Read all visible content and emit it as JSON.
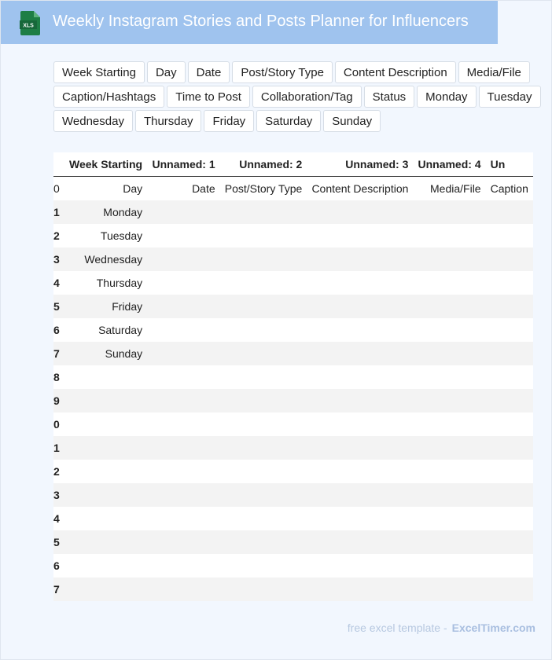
{
  "header": {
    "title": "Weekly Instagram Stories and Posts Planner for Influencers",
    "file_badge": "XLS",
    "accent_color": "#9fc3ee",
    "icon_color": "#1e7e45"
  },
  "chips": [
    "Week Starting",
    "Day",
    "Date",
    "Post/Story Type",
    "Content Description",
    "Media/File",
    "Caption/Hashtags",
    "Time to Post",
    "Collaboration/Tag",
    "Status",
    "Monday",
    "Tuesday",
    "Wednesday",
    "Thursday",
    "Friday",
    "Saturday",
    "Sunday"
  ],
  "table": {
    "header_row": [
      "Week Starting",
      "Unnamed: 1",
      "Unnamed: 2",
      "Unnamed: 3",
      "Unnamed: 4",
      "Un"
    ],
    "sub_header_row": [
      "Day",
      "Date",
      "Post/Story Type",
      "Content Description",
      "Media/File",
      "Caption"
    ],
    "first_index": "0",
    "rows": [
      {
        "idx": "1",
        "day": "Monday"
      },
      {
        "idx": "2",
        "day": "Tuesday"
      },
      {
        "idx": "3",
        "day": "Wednesday"
      },
      {
        "idx": "4",
        "day": "Thursday"
      },
      {
        "idx": "5",
        "day": "Friday"
      },
      {
        "idx": "6",
        "day": "Saturday"
      },
      {
        "idx": "7",
        "day": "Sunday"
      },
      {
        "idx": "8",
        "day": ""
      },
      {
        "idx": "9",
        "day": ""
      },
      {
        "idx": "0",
        "day": ""
      },
      {
        "idx": "1",
        "day": ""
      },
      {
        "idx": "2",
        "day": ""
      },
      {
        "idx": "3",
        "day": ""
      },
      {
        "idx": "4",
        "day": ""
      },
      {
        "idx": "5",
        "day": ""
      },
      {
        "idx": "6",
        "day": ""
      },
      {
        "idx": "7",
        "day": ""
      }
    ]
  },
  "footer": {
    "text": "free excel template -",
    "brand": "ExcelTimer.com"
  }
}
